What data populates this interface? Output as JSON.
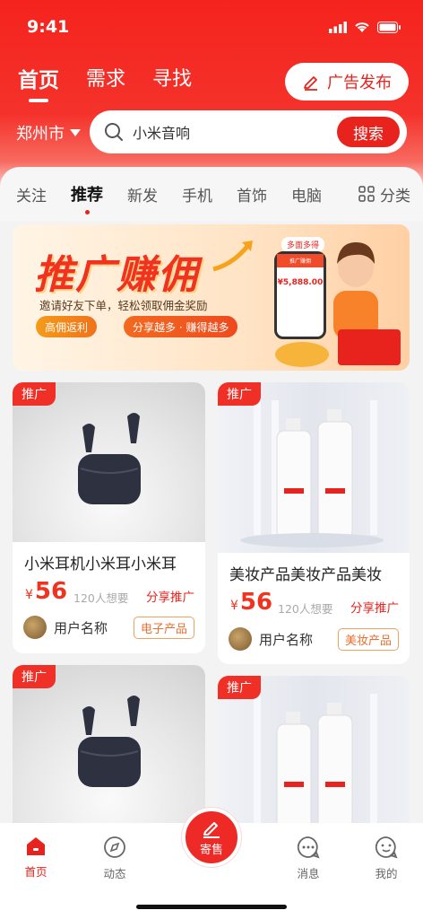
{
  "status": {
    "time": "9:41"
  },
  "topnav": {
    "tabs": [
      "首页",
      "需求",
      "寻找"
    ],
    "publish": "广告发布"
  },
  "location": {
    "city": "郑州市"
  },
  "search": {
    "query": "小米音响",
    "button": "搜索"
  },
  "categories": {
    "items": [
      "关注",
      "推荐",
      "新发",
      "手机",
      "首饰",
      "电脑"
    ],
    "more": "分类"
  },
  "banner": {
    "title": "推广赚佣",
    "subtitle": "邀请好友下单，轻松领取佣金奖励",
    "pill1": "高佣返利",
    "pill2": "分享越多 · 赚得越多",
    "badge": "多面多得",
    "phone_header": "推广赚佣",
    "phone_amount": "¥5,888.00"
  },
  "products": [
    {
      "promo": "推广",
      "title": "小米耳机小米耳小米耳",
      "currency": "¥",
      "price": "56",
      "want": "120人想要",
      "share": "分享推广",
      "user": "用户名称",
      "tag": "电子产品"
    },
    {
      "promo": "推广",
      "title": "美妆产品美妆产品美妆",
      "currency": "¥",
      "price": "56",
      "want": "120人想要",
      "share": "分享推广",
      "user": "用户名称",
      "tag": "美妆产品"
    },
    {
      "promo": "推广"
    },
    {
      "promo": "推广"
    }
  ],
  "tabbar": {
    "home": "首页",
    "feed": "动态",
    "consign": "寄售",
    "messages": "消息",
    "mine": "我的"
  },
  "colors": {
    "primary": "#e8231e",
    "accent_orange": "#e87030"
  }
}
